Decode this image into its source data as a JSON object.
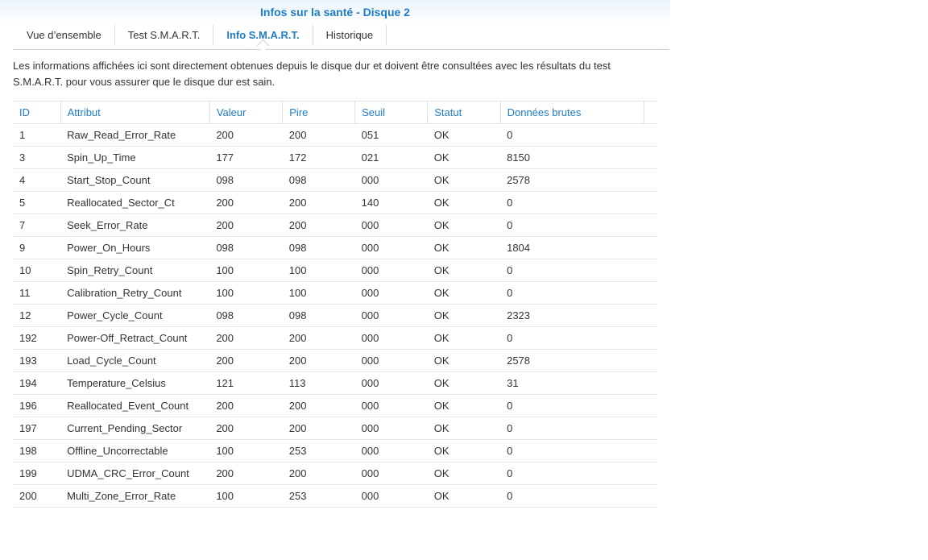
{
  "window": {
    "title": "Infos sur la santé - Disque 2"
  },
  "tabs": [
    {
      "label": "Vue d’ensemble",
      "active": false
    },
    {
      "label": "Test S.M.A.R.T.",
      "active": false
    },
    {
      "label": "Info S.M.A.R.T.",
      "active": true
    },
    {
      "label": "Historique",
      "active": false
    }
  ],
  "description": "Les informations affichées ici sont directement obtenues depuis le disque dur et doivent être consultées avec les résultats du test S.M.A.R.T. pour vous assurer que le disque dur est sain.",
  "table": {
    "headers": [
      "ID",
      "Attribut",
      "Valeur",
      "Pire",
      "Seuil",
      "Statut",
      "Données brutes"
    ],
    "rows": [
      [
        "1",
        "Raw_Read_Error_Rate",
        "200",
        "200",
        "051",
        "OK",
        "0"
      ],
      [
        "3",
        "Spin_Up_Time",
        "177",
        "172",
        "021",
        "OK",
        "8150"
      ],
      [
        "4",
        "Start_Stop_Count",
        "098",
        "098",
        "000",
        "OK",
        "2578"
      ],
      [
        "5",
        "Reallocated_Sector_Ct",
        "200",
        "200",
        "140",
        "OK",
        "0"
      ],
      [
        "7",
        "Seek_Error_Rate",
        "200",
        "200",
        "000",
        "OK",
        "0"
      ],
      [
        "9",
        "Power_On_Hours",
        "098",
        "098",
        "000",
        "OK",
        "1804"
      ],
      [
        "10",
        "Spin_Retry_Count",
        "100",
        "100",
        "000",
        "OK",
        "0"
      ],
      [
        "11",
        "Calibration_Retry_Count",
        "100",
        "100",
        "000",
        "OK",
        "0"
      ],
      [
        "12",
        "Power_Cycle_Count",
        "098",
        "098",
        "000",
        "OK",
        "2323"
      ],
      [
        "192",
        "Power-Off_Retract_Count",
        "200",
        "200",
        "000",
        "OK",
        "0"
      ],
      [
        "193",
        "Load_Cycle_Count",
        "200",
        "200",
        "000",
        "OK",
        "2578"
      ],
      [
        "194",
        "Temperature_Celsius",
        "121",
        "113",
        "000",
        "OK",
        "31"
      ],
      [
        "196",
        "Reallocated_Event_Count",
        "200",
        "200",
        "000",
        "OK",
        "0"
      ],
      [
        "197",
        "Current_Pending_Sector",
        "200",
        "200",
        "000",
        "OK",
        "0"
      ],
      [
        "198",
        "Offline_Uncorrectable",
        "100",
        "253",
        "000",
        "OK",
        "0"
      ],
      [
        "199",
        "UDMA_CRC_Error_Count",
        "200",
        "200",
        "000",
        "OK",
        "0"
      ],
      [
        "200",
        "Multi_Zone_Error_Rate",
        "100",
        "253",
        "000",
        "OK",
        "0"
      ]
    ]
  },
  "colors": {
    "accent": "#1f7cc7",
    "text": "#333333",
    "border": "#dde3e8"
  }
}
